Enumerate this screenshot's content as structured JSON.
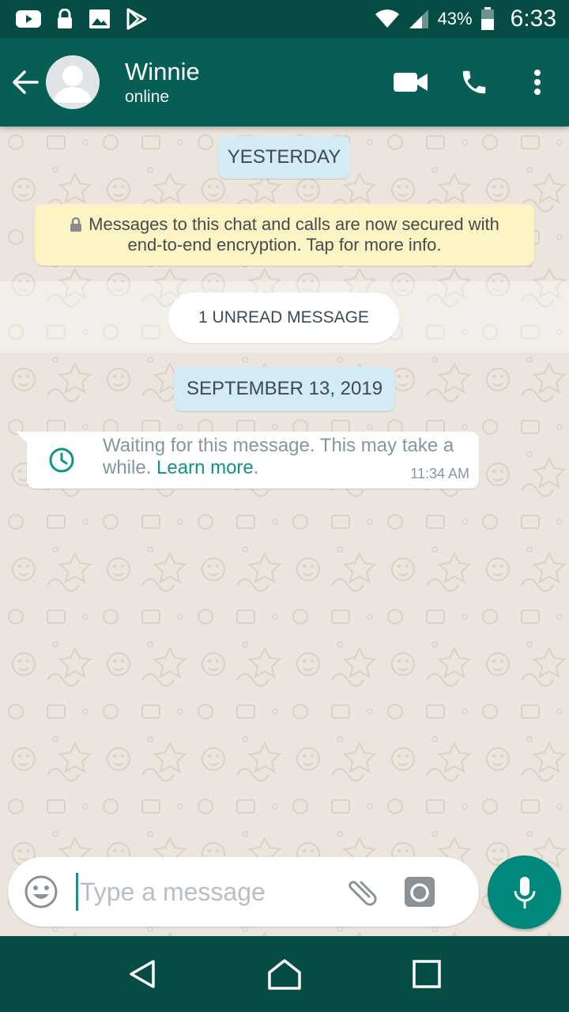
{
  "status_bar": {
    "battery": "43%",
    "time": "6:33"
  },
  "header": {
    "contact_name": "Winnie",
    "contact_status": "online"
  },
  "chat": {
    "date_yesterday": "YESTERDAY",
    "encryption_line1": "Messages to this chat and calls are now secured with",
    "encryption_line2": "end-to-end encryption. Tap for more info.",
    "unread": "1 UNREAD MESSAGE",
    "date_sep": "SEPTEMBER 13, 2019",
    "message": {
      "text": "Waiting for this message. This may take a while.",
      "link": "Learn more",
      "link_suffix": ".",
      "time": "11:34 AM"
    }
  },
  "input": {
    "placeholder": "Type a message"
  },
  "colors": {
    "header": "#075e54",
    "status_bar": "#054d44",
    "accent": "#00897b",
    "date_chip": "#d4eaf4",
    "encryption_bg": "#fdf4c5"
  },
  "icons": {
    "status": [
      "youtube-icon",
      "lock-icon",
      "image-icon",
      "play-store-icon",
      "wifi-icon",
      "signal-icon",
      "battery-icon"
    ],
    "header": [
      "back-arrow-icon",
      "video-call-icon",
      "phone-icon",
      "more-vert-icon"
    ],
    "input": [
      "emoji-icon",
      "attach-icon",
      "camera-icon",
      "mic-icon"
    ],
    "nav": [
      "back-triangle-icon",
      "home-icon",
      "recents-icon"
    ]
  }
}
